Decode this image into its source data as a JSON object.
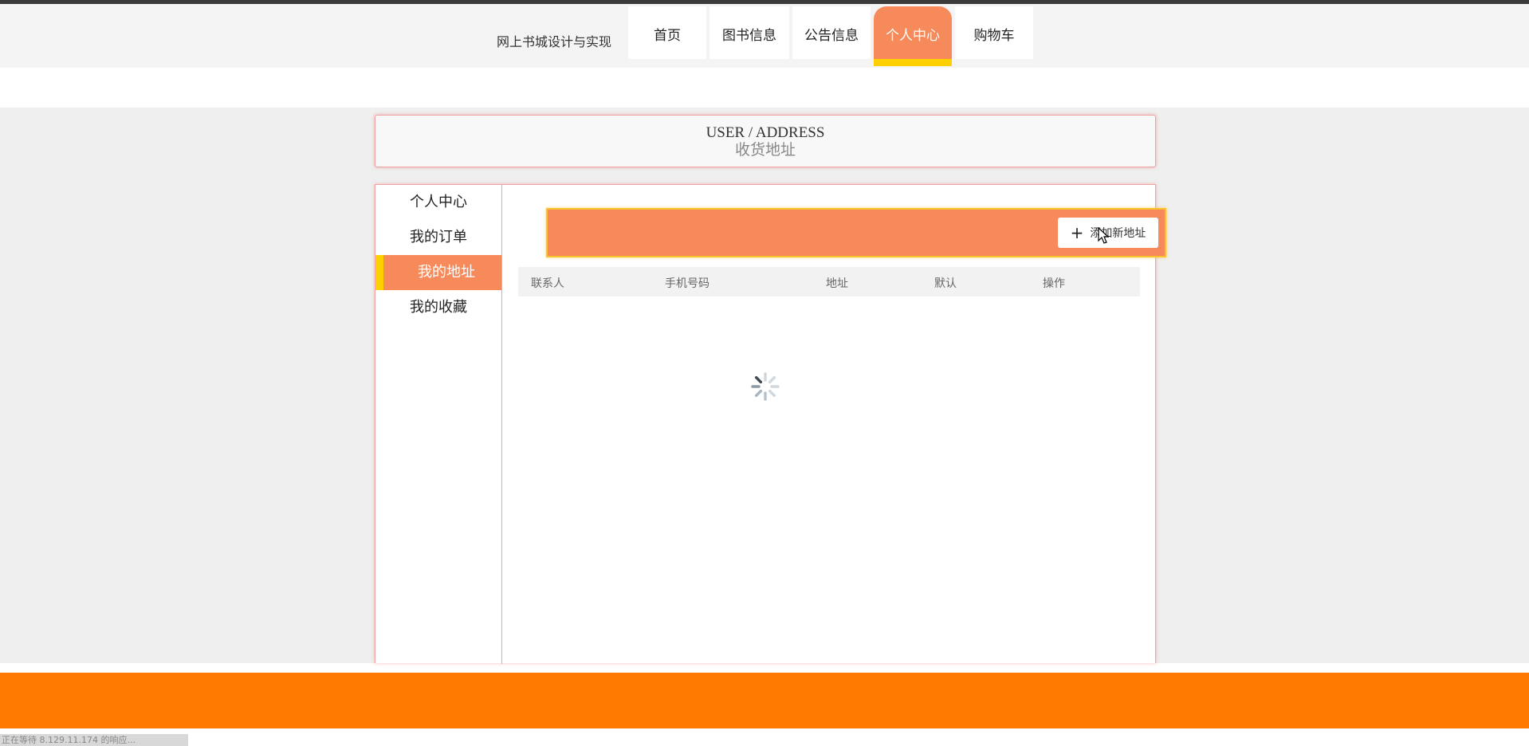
{
  "site": {
    "title": "网上书城设计与实现"
  },
  "nav": {
    "items": [
      {
        "label": "首页"
      },
      {
        "label": "图书信息"
      },
      {
        "label": "公告信息"
      },
      {
        "label": "个人中心"
      },
      {
        "label": "购物车"
      }
    ],
    "active_index": 3
  },
  "page_header": {
    "title_en": "USER / ADDRESS",
    "title_cn": "收货地址"
  },
  "sidebar": {
    "items": [
      {
        "label": "个人中心"
      },
      {
        "label": "我的订单"
      },
      {
        "label": "我的地址"
      },
      {
        "label": "我的收藏"
      }
    ],
    "active_index": 2
  },
  "toolbar": {
    "add_label": "添加新地址",
    "add_icon": "plus-icon"
  },
  "table": {
    "columns": [
      "联系人",
      "手机号码",
      "地址",
      "默认",
      "操作"
    ],
    "rows": []
  },
  "loading": {
    "icon": "spinner-icon"
  },
  "status_bar": {
    "text": "正在等待 8.129.11.174 的响应..."
  },
  "colors": {
    "accent": "#f78a5a",
    "highlight": "#ffd000",
    "footer": "#ff7a00",
    "border": "#f0a3a3"
  }
}
